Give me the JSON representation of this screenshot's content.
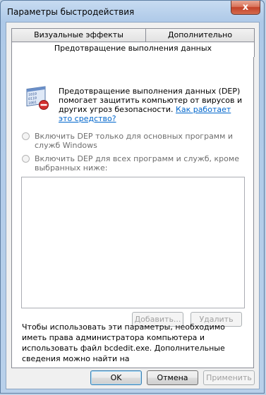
{
  "window": {
    "title": "Параметры быстродействия",
    "close_glyph": "x"
  },
  "tabs": [
    {
      "label": "Визуальные эффекты"
    },
    {
      "label": "Дополнительно"
    },
    {
      "label": "Предотвращение выполнения данных"
    }
  ],
  "dep": {
    "icon": "dep-shield-icon",
    "description": "Предотвращение выполнения данных (DEP) помогает защитить компьютер от вирусов и других угроз безопасности. ",
    "link": "Как работает это средство?",
    "radio_essential": "Включить DEP только для основных программ и служб Windows",
    "radio_all": "Включить DEP для всех программ и служб, кроме выбранных ниже:",
    "add_button": "Добавить...",
    "remove_button": "Удалить",
    "note": "Чтобы использовать эти параметры, необходимо иметь права администратора компьютера и использовать файл bcdedit.exe. Дополнительные сведения можно найти на"
  },
  "footer": {
    "ok": "OK",
    "cancel": "Отмена",
    "apply": "Применить"
  },
  "colors": {
    "link": "#0066cc",
    "disabled_text": "#a0a0a0"
  }
}
